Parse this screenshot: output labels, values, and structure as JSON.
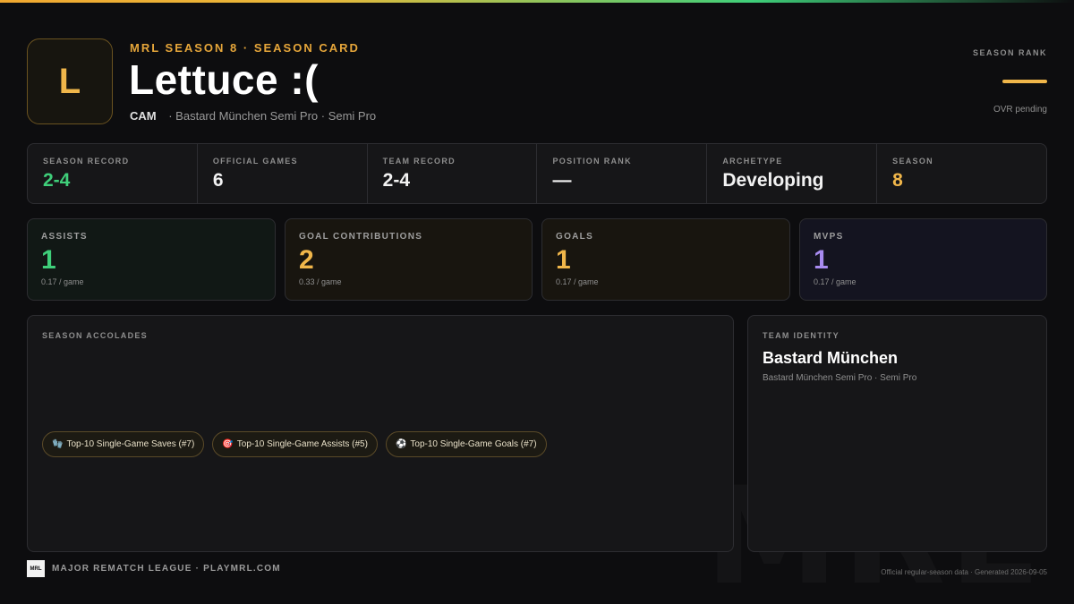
{
  "header": {
    "avatar_letter": "L",
    "eyebrow": "MRL SEASON 8 · SEASON CARD",
    "player_name": "Lettuce :(",
    "position": "CAM",
    "team_line": "· Bastard München Semi Pro · Semi Pro"
  },
  "rank": {
    "label": "SEASON RANK",
    "note": "OVR pending"
  },
  "stats": [
    {
      "label": "SEASON RECORD",
      "value": "2-4"
    },
    {
      "label": "OFFICIAL GAMES",
      "value": "6"
    },
    {
      "label": "TEAM RECORD",
      "value": "2-4"
    },
    {
      "label": "POSITION RANK",
      "value": "—"
    },
    {
      "label": "ARCHETYPE",
      "value": "Developing"
    },
    {
      "label": "SEASON",
      "value": "8"
    }
  ],
  "metrics": [
    {
      "label": "ASSISTS",
      "value": "1",
      "per_game": "0.17 / game"
    },
    {
      "label": "GOAL CONTRIBUTIONS",
      "value": "2",
      "per_game": "0.33 / game"
    },
    {
      "label": "GOALS",
      "value": "1",
      "per_game": "0.17 / game"
    },
    {
      "label": "MVPS",
      "value": "1",
      "per_game": "0.17 / game"
    }
  ],
  "accolades": {
    "label": "SEASON ACCOLADES",
    "items": [
      {
        "icon": "🧤",
        "icon_name": "gloves-icon",
        "text": "Top-10 Single-Game Saves (#7)"
      },
      {
        "icon": "🎯",
        "icon_name": "target-icon",
        "text": "Top-10 Single-Game Assists (#5)"
      },
      {
        "icon": "⚽",
        "icon_name": "soccer-ball-icon",
        "text": "Top-10 Single-Game Goals (#7)"
      }
    ]
  },
  "team": {
    "label": "TEAM IDENTITY",
    "name": "Bastard München",
    "sub": "Bastard München Semi Pro · Semi Pro"
  },
  "footer": {
    "logo_text": "MRL",
    "text": "MAJOR REMATCH LEAGUE · PLAYMRL.COM",
    "right_text": "Official regular-season data · Generated 2026-09-05",
    "watermark": "MRL"
  },
  "colors": {
    "gold": "#f0b64a",
    "green": "#3fcf7a",
    "purple": "#a88bf0",
    "background": "#0d0d0f"
  }
}
